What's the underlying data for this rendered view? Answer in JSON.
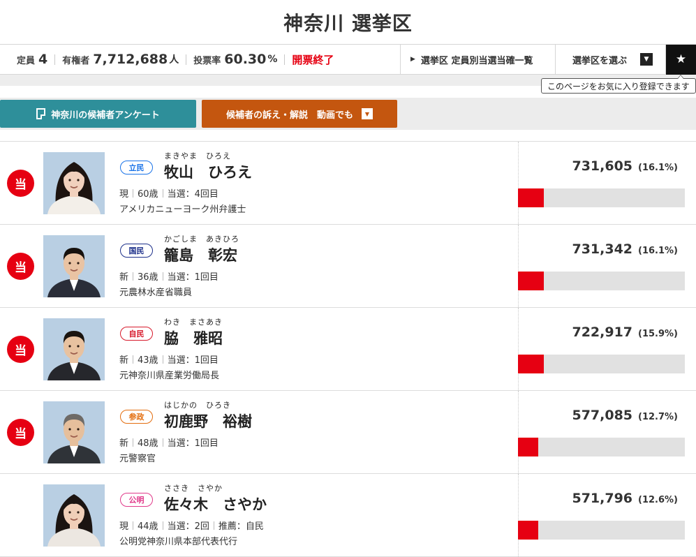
{
  "header": {
    "title": "神奈川 選挙区"
  },
  "stats": {
    "seats_label": "定員",
    "seats_value": "4",
    "voters_label": "有権者",
    "voters_value": "7,712,688",
    "voters_unit": "人",
    "turnout_label": "投票率",
    "turnout_value": "60.30",
    "turnout_unit": "%",
    "status": "開票終了"
  },
  "nav": {
    "list_link": "選挙区 定員別当選当確一覧",
    "district_select": "選挙区を選ぶ",
    "favorite_tooltip": "このページをお気に入り登録できます"
  },
  "buttons": {
    "survey": "神奈川の候補者アンケート",
    "videos": "候補者の訴え・解説　動画でも"
  },
  "winner_mark": "当",
  "party_colors": {
    "立民": "#1a73e8",
    "国民": "#1c2f8a",
    "自民": "#d7192b",
    "参政": "#e36d0e",
    "公明": "#e0398a"
  },
  "candidates": [
    {
      "elected": true,
      "party": "立民",
      "kana": "まきやま　ひろえ",
      "name": "牧山　ひろえ",
      "status": "現",
      "age": "60歳",
      "terms": "当選：4回目",
      "endorse": "",
      "career": "アメリカニューヨーク州弁護士",
      "votes": "731,605",
      "pct": "(16.1%)",
      "share": 0.161
    },
    {
      "elected": true,
      "party": "国民",
      "kana": "かごしま　あきひろ",
      "name": "籠島　彰宏",
      "status": "新",
      "age": "36歳",
      "terms": "当選：1回目",
      "endorse": "",
      "career": "元農林水産省職員",
      "votes": "731,342",
      "pct": "(16.1%)",
      "share": 0.161
    },
    {
      "elected": true,
      "party": "自民",
      "kana": "わき　まさあき",
      "name": "脇　雅昭",
      "status": "新",
      "age": "43歳",
      "terms": "当選：1回目",
      "endorse": "",
      "career": "元神奈川県産業労働局長",
      "votes": "722,917",
      "pct": "(15.9%)",
      "share": 0.159
    },
    {
      "elected": true,
      "party": "参政",
      "kana": "はじかの　ひろき",
      "name": "初鹿野　裕樹",
      "status": "新",
      "age": "48歳",
      "terms": "当選：1回目",
      "endorse": "",
      "career": "元警察官",
      "votes": "577,085",
      "pct": "(12.7%)",
      "share": 0.127
    },
    {
      "elected": false,
      "party": "公明",
      "kana": "ささき　さやか",
      "name": "佐々木　さやか",
      "status": "現",
      "age": "44歳",
      "terms": "当選：2回",
      "endorse": "推薦：自民",
      "career": "公明党神奈川県本部代表代行",
      "votes": "571,796",
      "pct": "(12.6%)",
      "share": 0.126
    }
  ]
}
